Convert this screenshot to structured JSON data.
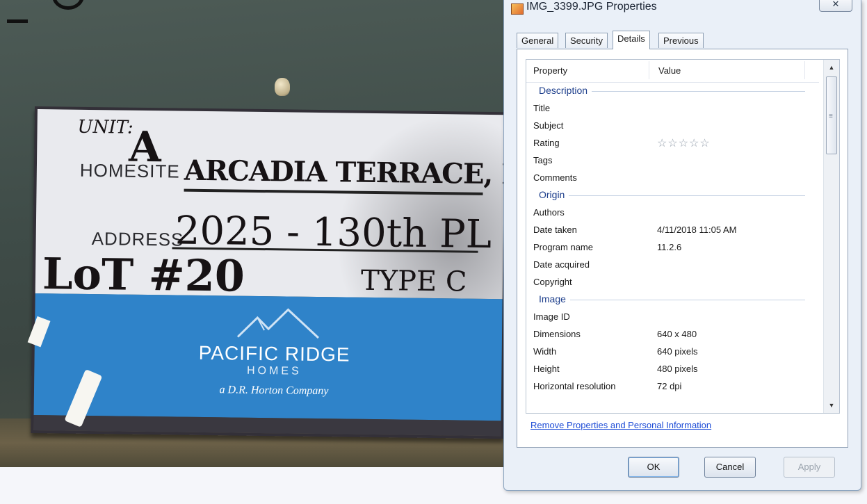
{
  "photo": {
    "sign": {
      "unit_label": "UNIT:",
      "unit_value": "A",
      "homesite_label": "HOMESITE",
      "homesite_value": "ARCADIA TERRACE, Bld C",
      "address_label": "ADDRESS",
      "address_value": "2025 - 130th PL",
      "lot_value": "LoT #20",
      "type_value": "TYPE C",
      "brand_name": "PACIFIC RIDGE",
      "brand_sub": "HOMES",
      "brand_tagline": "a D.R. Horton Company"
    }
  },
  "dialog": {
    "title": "IMG_3399.JPG Properties",
    "close_glyph": "✕",
    "tabs": [
      "General",
      "Security",
      "Details",
      "Previous Versions"
    ],
    "active_tab": "Details",
    "columns": {
      "property": "Property",
      "value": "Value"
    },
    "sections": [
      {
        "group": "Description",
        "rows": [
          {
            "key": "Title",
            "value": ""
          },
          {
            "key": "Subject",
            "value": ""
          },
          {
            "key": "Rating",
            "value": "☆☆☆☆☆"
          },
          {
            "key": "Tags",
            "value": ""
          },
          {
            "key": "Comments",
            "value": ""
          }
        ]
      },
      {
        "group": "Origin",
        "rows": [
          {
            "key": "Authors",
            "value": ""
          },
          {
            "key": "Date taken",
            "value": "4/11/2018 11:05 AM"
          },
          {
            "key": "Program name",
            "value": "11.2.6"
          },
          {
            "key": "Date acquired",
            "value": ""
          },
          {
            "key": "Copyright",
            "value": ""
          }
        ]
      },
      {
        "group": "Image",
        "rows": [
          {
            "key": "Image ID",
            "value": ""
          },
          {
            "key": "Dimensions",
            "value": "640 x 480"
          },
          {
            "key": "Width",
            "value": "640 pixels"
          },
          {
            "key": "Height",
            "value": "480 pixels"
          },
          {
            "key": "Horizontal resolution",
            "value": "72 dpi"
          }
        ]
      }
    ],
    "remove_link": "Remove Properties and Personal Information",
    "buttons": {
      "ok": "OK",
      "cancel": "Cancel",
      "apply": "Apply"
    },
    "icons": {
      "title": "jpg-file-icon",
      "scroll_up": "▲",
      "scroll_down": "▼",
      "grip": "≡"
    }
  }
}
